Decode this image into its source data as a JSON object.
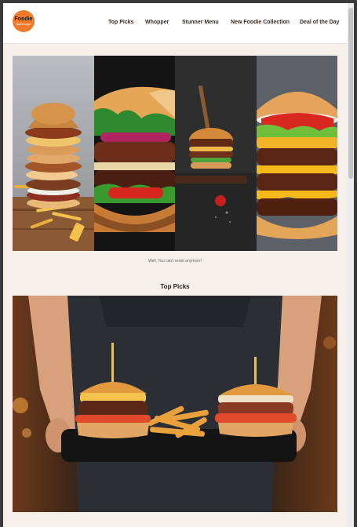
{
  "brand": {
    "name": "Foodie",
    "tagline": "Hamburger"
  },
  "nav": {
    "items": [
      {
        "label": "Top Picks"
      },
      {
        "label": "Whopper"
      },
      {
        "label": "Stunner Menu"
      },
      {
        "label": "New Foodie Collection"
      },
      {
        "label": "Deal of the Day"
      }
    ]
  },
  "hero": {
    "caption": "Well, You can't resist anymore!"
  },
  "top_picks": {
    "title": "Top Picks"
  },
  "colors": {
    "accent": "#f07a2a",
    "background": "#f5efe9",
    "nav_text": "#3a2a22"
  }
}
